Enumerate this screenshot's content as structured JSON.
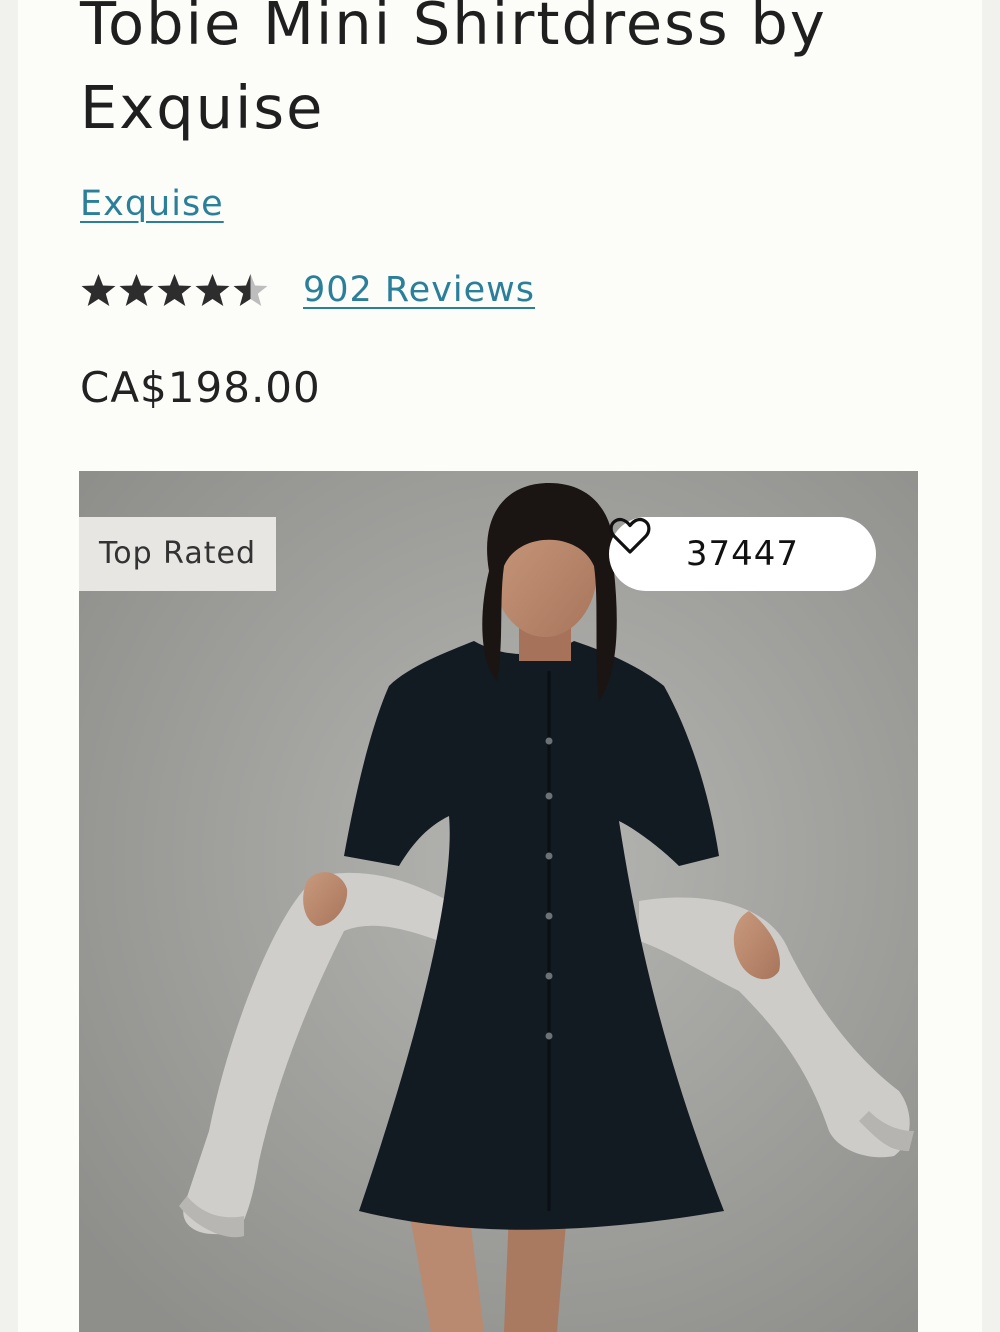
{
  "product": {
    "title": "Tobie Mini Shirtdress by Exquise",
    "brand": "Exquise",
    "rating": 4.5,
    "rating_max": 5,
    "reviews_label": "902 Reviews",
    "price": "CA$198.00"
  },
  "image": {
    "badge": "Top Rated",
    "wishlist_count": "37447",
    "wishlist_icon": "heart-outline-icon",
    "star_icon": "star-icon"
  },
  "colors": {
    "link": "#2a7f9a",
    "text": "#1f1f1f",
    "star_filled": "#2d2d2d",
    "star_empty": "#bdbdbd"
  }
}
